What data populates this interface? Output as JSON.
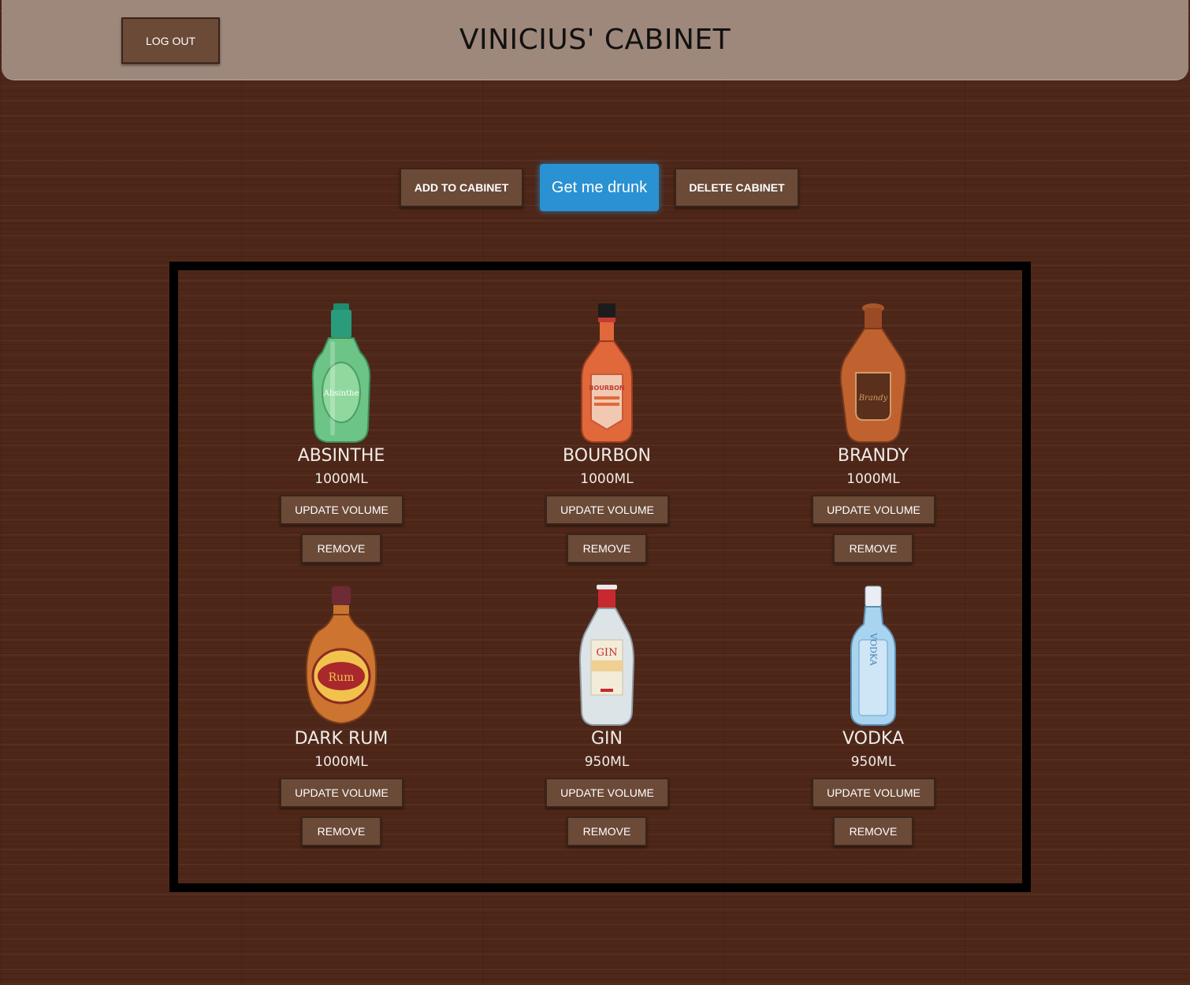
{
  "header": {
    "logout_label": "LOG OUT",
    "title": "VINICIUS' CABINET"
  },
  "actions": {
    "add_label": "ADD TO CABINET",
    "drunk_label": "Get me drunk",
    "delete_label": "DELETE CABINET"
  },
  "items": [
    {
      "name": "ABSINTHE",
      "volume": "1000ML",
      "update_label": "UPDATE VOLUME",
      "remove_label": "REMOVE",
      "icon": "absinthe-bottle-icon",
      "bottle_label": "Absinthe",
      "color": "#5fbf7a"
    },
    {
      "name": "BOURBON",
      "volume": "1000ML",
      "update_label": "UPDATE VOLUME",
      "remove_label": "REMOVE",
      "icon": "bourbon-bottle-icon",
      "bottle_label": "BOURBON",
      "color": "#e0683b"
    },
    {
      "name": "BRANDY",
      "volume": "1000ML",
      "update_label": "UPDATE VOLUME",
      "remove_label": "REMOVE",
      "icon": "brandy-bottle-icon",
      "bottle_label": "Brandy",
      "color": "#b2552c"
    },
    {
      "name": "DARK RUM",
      "volume": "1000ML",
      "update_label": "UPDATE VOLUME",
      "remove_label": "REMOVE",
      "icon": "rum-bottle-icon",
      "bottle_label": "Rum",
      "color": "#d0762f"
    },
    {
      "name": "GIN",
      "volume": "950ML",
      "update_label": "UPDATE VOLUME",
      "remove_label": "REMOVE",
      "icon": "gin-bottle-icon",
      "bottle_label": "GIN",
      "color": "#dfe6ea"
    },
    {
      "name": "VODKA",
      "volume": "950ML",
      "update_label": "UPDATE VOLUME",
      "remove_label": "REMOVE",
      "icon": "vodka-bottle-icon",
      "bottle_label": "VODKA",
      "color": "#a9d4f0"
    }
  ]
}
